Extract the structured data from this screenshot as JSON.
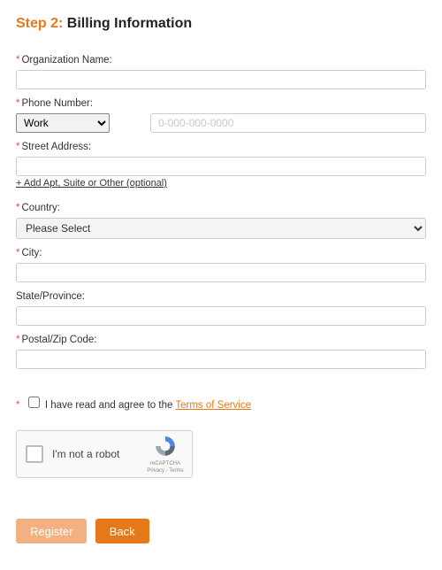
{
  "heading": {
    "step_prefix": "Step 2:",
    "title": "Billing Information"
  },
  "fields": {
    "org": {
      "label": "Organization Name:",
      "value": ""
    },
    "phone": {
      "label": "Phone Number:",
      "type_selected": "Work",
      "number_value": "",
      "number_placeholder": "0-000-000-0000"
    },
    "street": {
      "label": "Street Address:",
      "value": ""
    },
    "add_apt_link": "+ Add Apt, Suite or Other (optional)",
    "country": {
      "label": "Country:",
      "selected": "Please Select"
    },
    "city": {
      "label": "City:",
      "value": ""
    },
    "state": {
      "label": "State/Province:",
      "value": ""
    },
    "postal": {
      "label": "Postal/Zip Code:",
      "value": ""
    }
  },
  "terms": {
    "checkbox_checked": false,
    "text_before": "I have read and agree to the ",
    "link_text": "Terms of Service"
  },
  "captcha": {
    "label": "I'm not a robot",
    "brand": "reCAPTCHA",
    "privacy": "Privacy",
    "terms": "Terms"
  },
  "buttons": {
    "register": "Register",
    "back": "Back"
  },
  "colors": {
    "accent": "#e77817",
    "required": "#d9534f"
  }
}
